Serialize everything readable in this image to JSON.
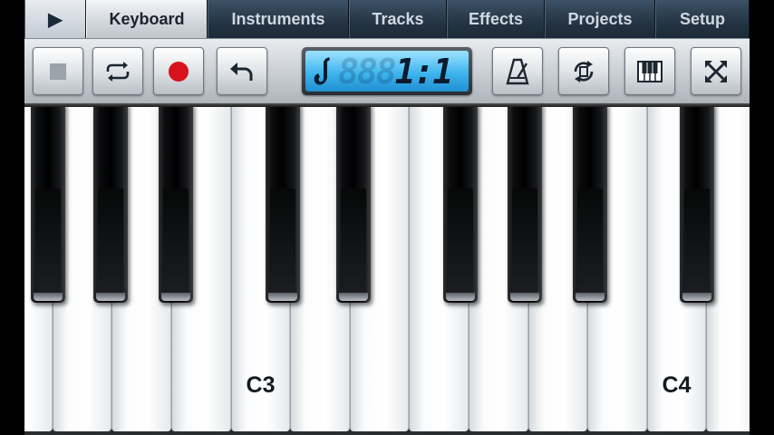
{
  "tabs": {
    "play": "▶",
    "items": [
      "Keyboard",
      "Instruments",
      "Tracks",
      "Effects",
      "Projects",
      "Setup"
    ],
    "active": "Keyboard"
  },
  "toolbar": {
    "left_buttons": [
      "stop-icon",
      "loop-icon",
      "record-icon",
      "undo-icon"
    ],
    "right_buttons": [
      "metronome-icon",
      "rotate-icon",
      "piano-icon",
      "fullscreen-icon"
    ],
    "display": {
      "instrument_icon": "saxophone-icon",
      "ghost_digits": "888",
      "position": "1:1"
    }
  },
  "keyboard": {
    "labels": {
      "c3": "C3",
      "c4": "C4"
    }
  },
  "colors": {
    "record": "#d8121c",
    "lcd": "#3fb5ee",
    "tab_active": "#e2e6ea",
    "tab_inactive": "#2c3e50"
  }
}
